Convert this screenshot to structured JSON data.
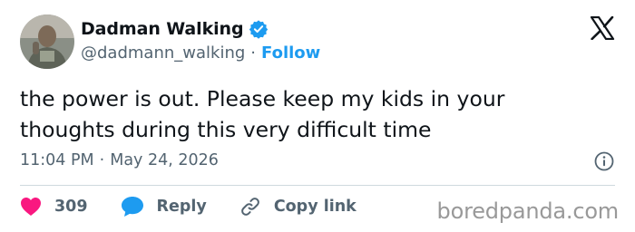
{
  "author": {
    "display_name": "Dadman Walking",
    "handle": "@dadmann_walking",
    "separator": "·",
    "follow_label": "Follow",
    "avatar_icon": "user-avatar",
    "verified_icon": "verified-badge-icon"
  },
  "brand": {
    "icon": "x-logo-icon"
  },
  "tweet": {
    "text": "the power is out. Please keep my kids in your thoughts during this very difficult time",
    "time": "11:04 PM",
    "date_separator": "·",
    "date": "May 24, 2026",
    "info_icon": "info-icon"
  },
  "actions": {
    "like_count": "309",
    "like_icon": "heart-icon",
    "reply_label": "Reply",
    "reply_icon": "reply-bubble-icon",
    "copy_label": "Copy link",
    "copy_icon": "link-icon"
  },
  "watermark": "boredpanda.com",
  "colors": {
    "accent": "#1d9bf0",
    "like": "#f91880",
    "muted": "#536471",
    "text": "#0f1419",
    "divider": "#cfd9de"
  }
}
